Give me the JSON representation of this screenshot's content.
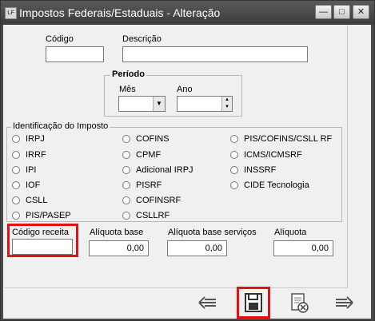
{
  "window": {
    "title": "Impostos Federais/Estaduais - Alteração",
    "app_icon_text": "LF"
  },
  "fields": {
    "codigo_label": "Código",
    "codigo_value": "",
    "descricao_label": "Descrição",
    "descricao_value": "",
    "periodo_label": "Período",
    "mes_label": "Mês",
    "mes_value": "",
    "ano_label": "Ano",
    "ano_value": ""
  },
  "imposto_group": {
    "legend": "Identificação do Imposto",
    "col1": [
      "IRPJ",
      "IRRF",
      "IPI",
      "IOF",
      "CSLL",
      "PIS/PASEP"
    ],
    "col2": [
      "COFINS",
      "CPMF",
      "Adicional IRPJ",
      "PISRF",
      "COFINSRF",
      "CSLLRF"
    ],
    "col3": [
      "PIS/COFINS/CSLL RF",
      "ICMS/ICMSRF",
      "INSSRF",
      "CIDE Tecnologia"
    ]
  },
  "bottom": {
    "codigo_receita_label": "Código receita",
    "codigo_receita_value": "",
    "aliquota_base_label": "Alíquota base",
    "aliquota_base_value": "0,00",
    "aliquota_base_servicos_label": "Alíquota base serviços",
    "aliquota_base_servicos_value": "0,00",
    "aliquota_label": "Alíquota",
    "aliquota_value": "0,00"
  },
  "colors": {
    "highlight": "#e31212",
    "titlebar": "#3c3c3c"
  },
  "toolbar": {
    "icons": [
      "arrow-left-icon",
      "save-icon",
      "cancel-document-icon",
      "arrow-right-icon"
    ]
  }
}
